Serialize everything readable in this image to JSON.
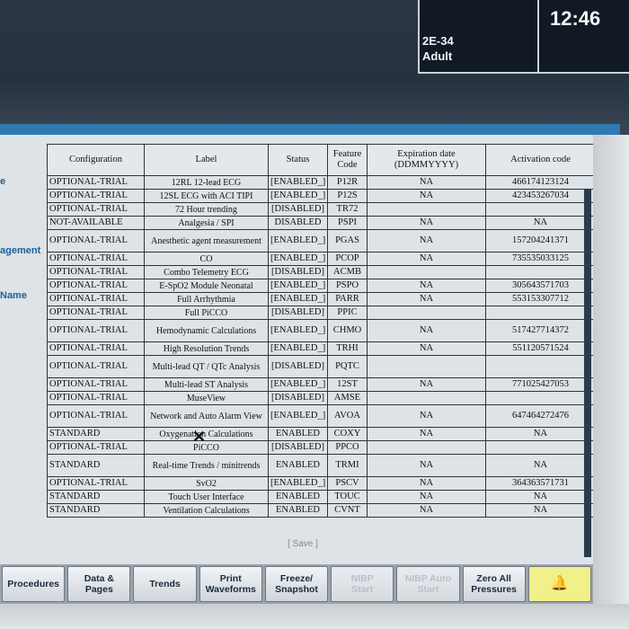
{
  "status": {
    "bed": "2E-34",
    "patient_category": "Adult",
    "time": "12:46"
  },
  "left_fragments": [
    "e",
    "agement",
    "Name"
  ],
  "table": {
    "headers": [
      "Configuration",
      "Label",
      "Status",
      "Feature Code",
      "Expiration date (DDMMYYYY)",
      "Activation code"
    ],
    "rows": [
      {
        "cfg": "OPTIONAL-TRIAL",
        "label": "12RL 12-lead ECG",
        "status": "[ENABLED_]",
        "code": "P12R",
        "exp": "NA",
        "act": "466174123124"
      },
      {
        "cfg": "OPTIONAL-TRIAL",
        "label": "12SL ECG with ACI TIPI",
        "status": "[ENABLED_]",
        "code": "P12S",
        "exp": "NA",
        "act": "423453267034"
      },
      {
        "cfg": "OPTIONAL-TRIAL",
        "label": "72 Hour trending",
        "status": "[DISABLED]",
        "code": "TR72",
        "exp": "",
        "act": ""
      },
      {
        "cfg": "NOT-AVAILABLE",
        "label": "Analgesia / SPI",
        "status": "DISABLED",
        "code": "PSPI",
        "exp": "NA",
        "act": "NA"
      },
      {
        "cfg": "OPTIONAL-TRIAL",
        "label": "Anesthetic agent measurement",
        "status": "[ENABLED_]",
        "code": "PGAS",
        "exp": "NA",
        "act": "157204241371"
      },
      {
        "cfg": "OPTIONAL-TRIAL",
        "label": "CO",
        "status": "[ENABLED_]",
        "code": "PCOP",
        "exp": "NA",
        "act": "735535033125"
      },
      {
        "cfg": "OPTIONAL-TRIAL",
        "label": "Combo Telemetry ECG",
        "status": "[DISABLED]",
        "code": "ACMB",
        "exp": "",
        "act": ""
      },
      {
        "cfg": "OPTIONAL-TRIAL",
        "label": "E-SpO2 Module Neonatal",
        "status": "[ENABLED_]",
        "code": "PSPO",
        "exp": "NA",
        "act": "305643571703"
      },
      {
        "cfg": "OPTIONAL-TRIAL",
        "label": "Full Arrhythmia",
        "status": "[ENABLED_]",
        "code": "PARR",
        "exp": "NA",
        "act": "553153307712"
      },
      {
        "cfg": "OPTIONAL-TRIAL",
        "label": "Full PiCCO",
        "status": "[DISABLED]",
        "code": "PPIC",
        "exp": "",
        "act": ""
      },
      {
        "cfg": "OPTIONAL-TRIAL",
        "label": "Hemodynamic Calculations",
        "status": "[ENABLED_]",
        "code": "CHMO",
        "exp": "NA",
        "act": "517427714372"
      },
      {
        "cfg": "OPTIONAL-TRIAL",
        "label": "High Resolution Trends",
        "status": "[ENABLED_]",
        "code": "TRHI",
        "exp": "NA",
        "act": "551120571524"
      },
      {
        "cfg": "OPTIONAL-TRIAL",
        "label": "Multi-lead QT / QTc Analysis",
        "status": "[DISABLED]",
        "code": "PQTC",
        "exp": "",
        "act": ""
      },
      {
        "cfg": "OPTIONAL-TRIAL",
        "label": "Multi-lead ST Analysis",
        "status": "[ENABLED_]",
        "code": "12ST",
        "exp": "NA",
        "act": "771025427053"
      },
      {
        "cfg": "OPTIONAL-TRIAL",
        "label": "MuseView",
        "status": "[DISABLED]",
        "code": "AMSE",
        "exp": "",
        "act": ""
      },
      {
        "cfg": "OPTIONAL-TRIAL",
        "label": "Network and Auto Alarm View",
        "status": "[ENABLED_]",
        "code": "AVOA",
        "exp": "NA",
        "act": "647464272476"
      },
      {
        "cfg": "STANDARD",
        "label": "Oxygenation Calculations",
        "status": "ENABLED",
        "code": "COXY",
        "exp": "NA",
        "act": "NA"
      },
      {
        "cfg": "OPTIONAL-TRIAL",
        "label": "PiCCO",
        "status": "[DISABLED]",
        "code": "PPCO",
        "exp": "",
        "act": ""
      },
      {
        "cfg": "STANDARD",
        "label": "Real-time Trends / minitrends",
        "status": "ENABLED",
        "code": "TRMI",
        "exp": "NA",
        "act": "NA"
      },
      {
        "cfg": "OPTIONAL-TRIAL",
        "label": "SvO2",
        "status": "[ENABLED_]",
        "code": "PSCV",
        "exp": "NA",
        "act": "364363571731"
      },
      {
        "cfg": "STANDARD",
        "label": "Touch User Interface",
        "status": "ENABLED",
        "code": "TOUC",
        "exp": "NA",
        "act": "NA"
      },
      {
        "cfg": "STANDARD",
        "label": "Ventilation Calculations",
        "status": "ENABLED",
        "code": "CVNT",
        "exp": "NA",
        "act": "NA"
      }
    ]
  },
  "save_label": "[ Save ]",
  "softkeys": [
    {
      "label": "Procedures",
      "enabled": true
    },
    {
      "label": "Data &\nPages",
      "enabled": true
    },
    {
      "label": "Trends",
      "enabled": true
    },
    {
      "label": "Print\nWaveforms",
      "enabled": true
    },
    {
      "label": "Freeze/\nSnapshot",
      "enabled": true
    },
    {
      "label": "NIBP\nStart",
      "enabled": false
    },
    {
      "label": "NIBP Auto\nStart",
      "enabled": false
    },
    {
      "label": "Zero All\nPressures",
      "enabled": true
    }
  ],
  "alarm_icon": "bell-icon",
  "colors": {
    "header": "#2f7ab3",
    "alarm": "#f1f08a"
  }
}
